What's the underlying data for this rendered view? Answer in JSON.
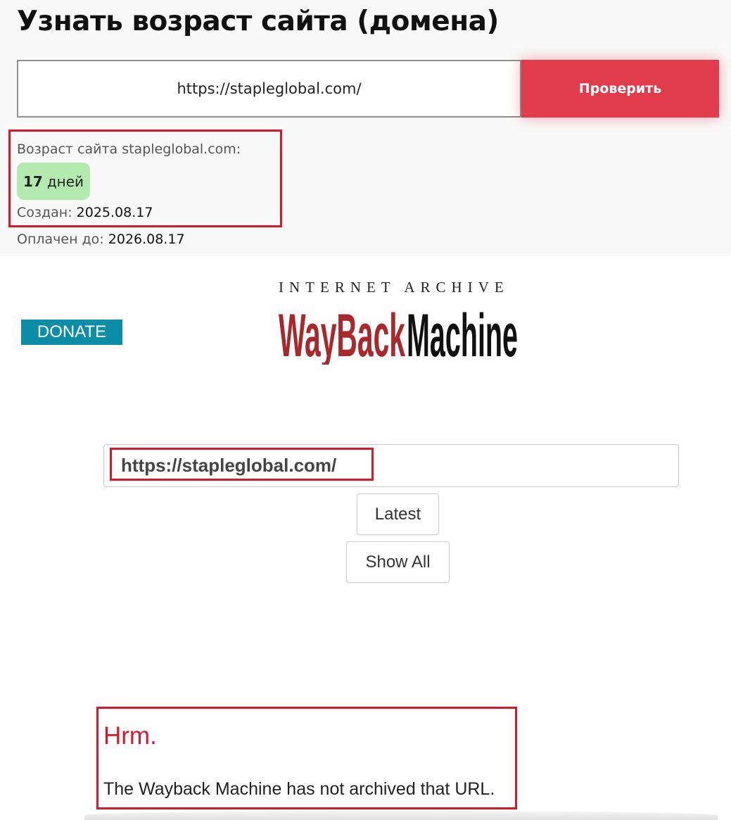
{
  "age_checker": {
    "title": "Узнать возраст сайта (домена)",
    "url_value": "https://stapleglobal.com/",
    "check_button_label": "Проверить",
    "age_label": "Возраст сайта stapleglobal.com:",
    "age_number": "17",
    "age_unit": "дней",
    "created_label": "Создан:",
    "created_value": "2025.08.17",
    "paid_label": "Оплачен до:",
    "paid_value": "2026.08.17",
    "accent_color": "#e03c4b",
    "badge_color": "#b3eab0"
  },
  "wayback": {
    "donate_label": "DONATE",
    "logo_top": "INTERNET ARCHIVE",
    "logo_wayback": "WayBack",
    "logo_machine": "Machine",
    "search_value": "https://stapleglobal.com/",
    "latest_label": "Latest",
    "show_all_label": "Show All",
    "error_title": "Hrm.",
    "error_message": "The Wayback Machine has not archived that URL.",
    "donate_color": "#0d8ea6",
    "logo_red": "#a8282c"
  }
}
